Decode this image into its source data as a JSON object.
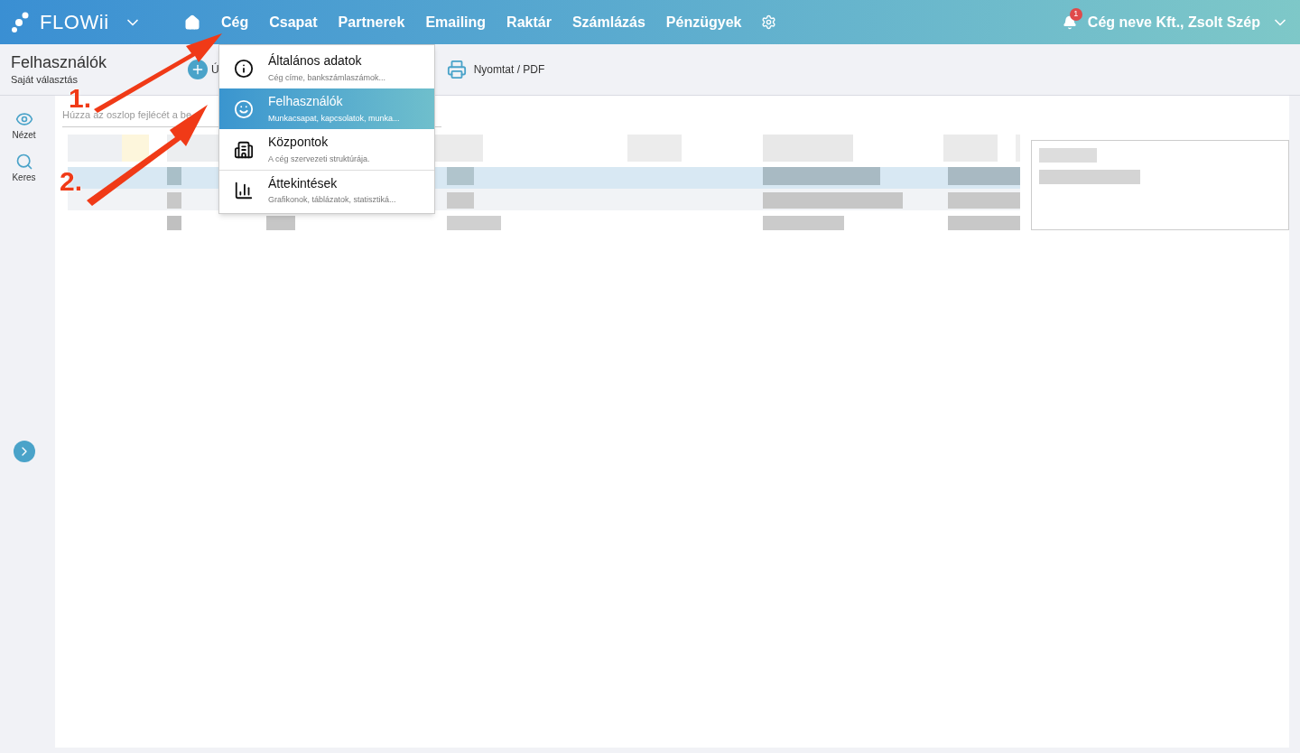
{
  "logo": {
    "text": "FLOWii"
  },
  "nav": [
    {
      "label": "Cég"
    },
    {
      "label": "Csapat"
    },
    {
      "label": "Partnerek"
    },
    {
      "label": "Emailing"
    },
    {
      "label": "Raktár"
    },
    {
      "label": "Számlázás"
    },
    {
      "label": "Pénzügyek"
    }
  ],
  "notifications": {
    "count": "1"
  },
  "user": {
    "label": "Cég neve Kft., Zsolt Szép"
  },
  "page": {
    "title": "Felhasználók",
    "subtitle": "Saját választás"
  },
  "toolbar": {
    "add_label": "Ú",
    "print_label": "Nyomtat / PDF"
  },
  "sidebar": [
    {
      "label": "Nézet",
      "kind": "view"
    },
    {
      "label": "Keres",
      "kind": "search"
    }
  ],
  "grouping": {
    "placeholder": "Húzza az oszlop fejlécét a be"
  },
  "menu": [
    {
      "title": "Általános adatok",
      "subtitle": "Cég címe, bankszámlaszámok...",
      "kind": "info",
      "selected": false
    },
    {
      "title": "Felhasználók",
      "subtitle": "Munkacsapat, kapcsolatok, munka...",
      "kind": "face",
      "selected": true
    },
    {
      "title": "Központok",
      "subtitle": "A cég szervezeti struktúrája.",
      "kind": "building",
      "selected": false
    },
    {
      "title": "Áttekintések",
      "subtitle": "Grafikonok, táblázatok, statisztiká...",
      "kind": "chart",
      "selected": false
    }
  ],
  "annotations": [
    {
      "label": "1."
    },
    {
      "label": "2."
    }
  ]
}
